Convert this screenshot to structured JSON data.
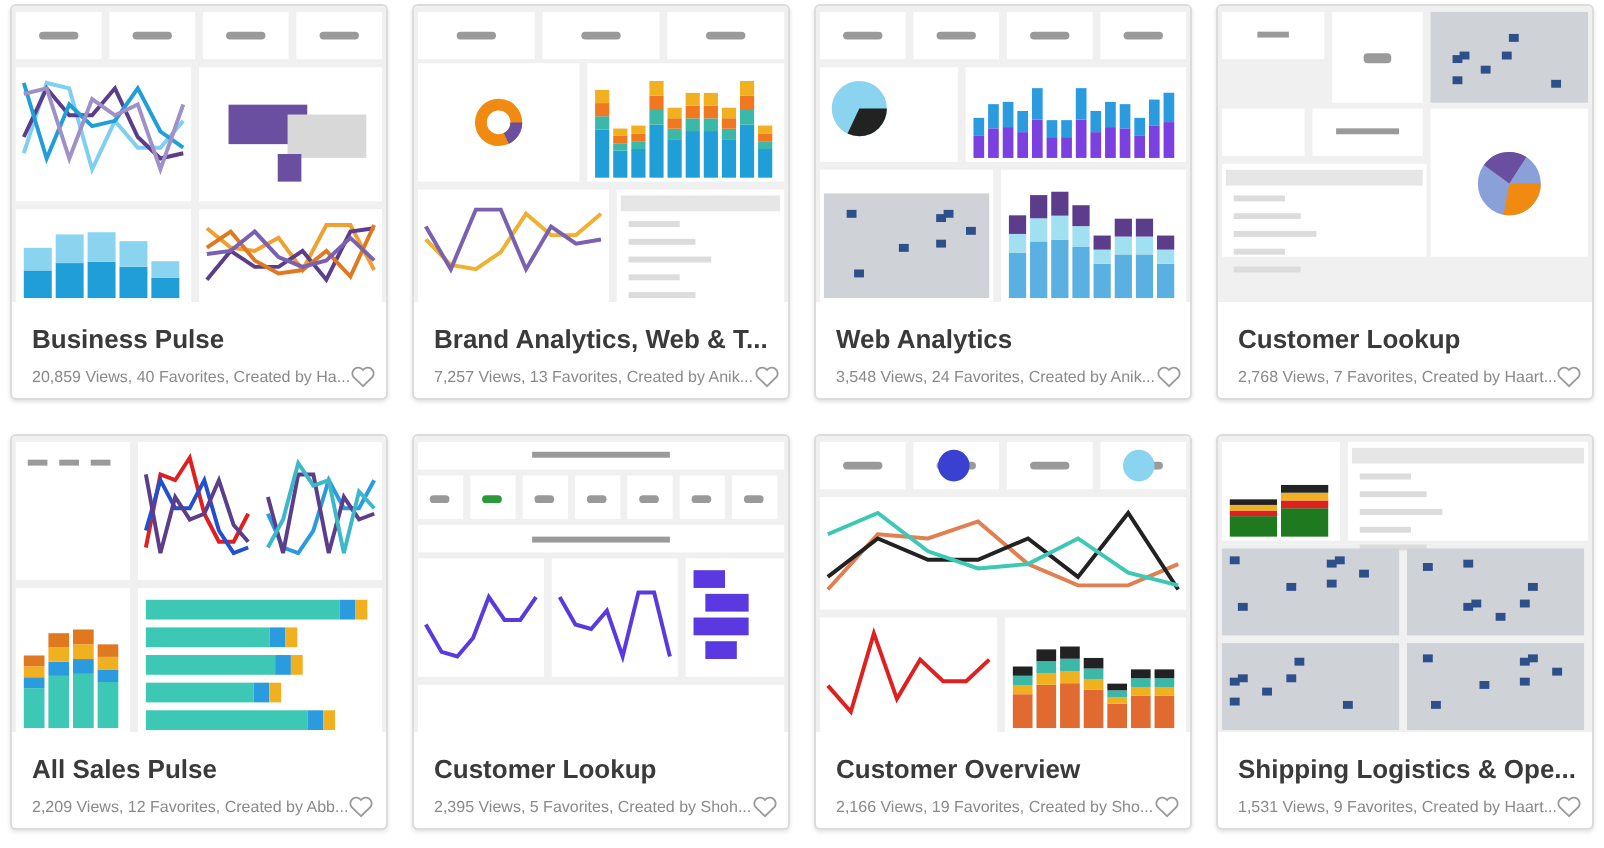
{
  "dashboards": [
    {
      "title": "Business Pulse",
      "meta": "20,859 Views, 40 Favorites, Created by Ha..."
    },
    {
      "title": "Brand Analytics, Web & T...",
      "meta": "7,257 Views, 13 Favorites, Created by Anik..."
    },
    {
      "title": "Web Analytics",
      "meta": "3,548 Views, 24 Favorites, Created by Anik..."
    },
    {
      "title": "Customer Lookup",
      "meta": "2,768 Views, 7 Favorites, Created by Haart..."
    },
    {
      "title": "All Sales Pulse",
      "meta": "2,209 Views, 12 Favorites, Created by Abb..."
    },
    {
      "title": "Customer Lookup",
      "meta": "2,395 Views, 5 Favorites, Created by Shoh..."
    },
    {
      "title": "Customer Overview",
      "meta": "2,166 Views, 19 Favorites, Created by Sho..."
    },
    {
      "title": "Shipping Logistics & Ope...",
      "meta": "1,531 Views, 9 Favorites, Created by Haart..."
    }
  ]
}
